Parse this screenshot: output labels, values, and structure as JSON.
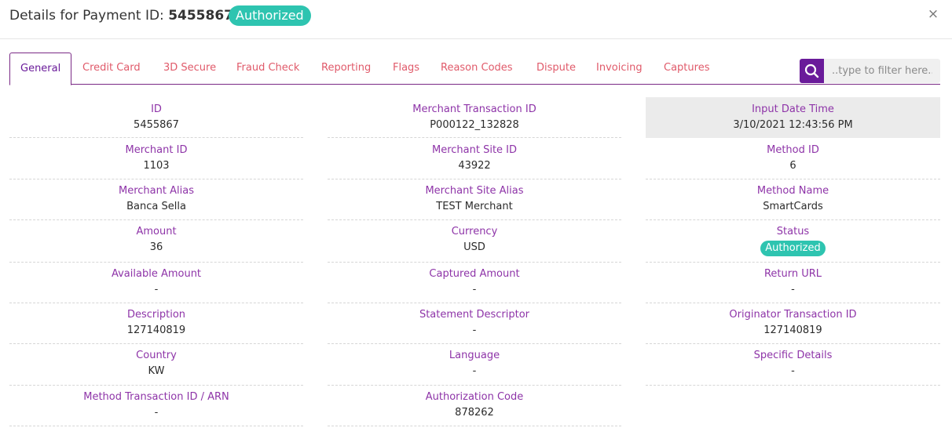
{
  "header": {
    "title_prefix": "Details for Payment ID: ",
    "payment_id": "5455867",
    "status": "Authorized",
    "close_glyph": "×"
  },
  "tabs": [
    {
      "label": "General",
      "active": true
    },
    {
      "label": "Credit Card"
    },
    {
      "label": "3D Secure"
    },
    {
      "label": "Fraud Check"
    },
    {
      "label": "Reporting"
    },
    {
      "label": "Flags"
    },
    {
      "label": "Reason Codes"
    },
    {
      "label": "Dispute"
    },
    {
      "label": "Invoicing"
    },
    {
      "label": "Captures"
    }
  ],
  "filter": {
    "placeholder": "..type to filter here..",
    "icon": "search-icon"
  },
  "fields": {
    "id": {
      "label": "ID",
      "value": "5455867"
    },
    "merchant_transaction_id": {
      "label": "Merchant Transaction ID",
      "value": "P000122_132828"
    },
    "input_date_time": {
      "label": "Input Date Time",
      "value": "3/10/2021 12:43:56 PM"
    },
    "merchant_id": {
      "label": "Merchant ID",
      "value": "1103"
    },
    "merchant_site_id": {
      "label": "Merchant Site ID",
      "value": "43922"
    },
    "method_id": {
      "label": "Method ID",
      "value": "6"
    },
    "merchant_alias": {
      "label": "Merchant Alias",
      "value": "Banca Sella"
    },
    "merchant_site_alias": {
      "label": "Merchant Site Alias",
      "value": "TEST Merchant"
    },
    "method_name": {
      "label": "Method Name",
      "value": "SmartCards"
    },
    "amount": {
      "label": "Amount",
      "value": "36"
    },
    "currency": {
      "label": "Currency",
      "value": "USD"
    },
    "status": {
      "label": "Status",
      "value": "Authorized"
    },
    "available_amount": {
      "label": "Available Amount",
      "value": "-"
    },
    "captured_amount": {
      "label": "Captured Amount",
      "value": "-"
    },
    "return_url": {
      "label": "Return URL",
      "value": "-"
    },
    "description": {
      "label": "Description",
      "value": "127140819"
    },
    "statement_descriptor": {
      "label": "Statement Descriptor",
      "value": "-"
    },
    "originator_transaction_id": {
      "label": "Originator Transaction ID",
      "value": "127140819"
    },
    "country": {
      "label": "Country",
      "value": "KW"
    },
    "language": {
      "label": "Language",
      "value": "-"
    },
    "specific_details": {
      "label": "Specific Details",
      "value": "-"
    },
    "method_transaction_id_arn": {
      "label": "Method Transaction ID / ARN",
      "value": "-"
    },
    "authorization_code": {
      "label": "Authorization Code",
      "value": "878262"
    }
  },
  "colors": {
    "accent": "#6a1b9a",
    "label": "#8e34a8",
    "tab_text": "#e05a6a",
    "status_badge": "#2ec4b0"
  }
}
